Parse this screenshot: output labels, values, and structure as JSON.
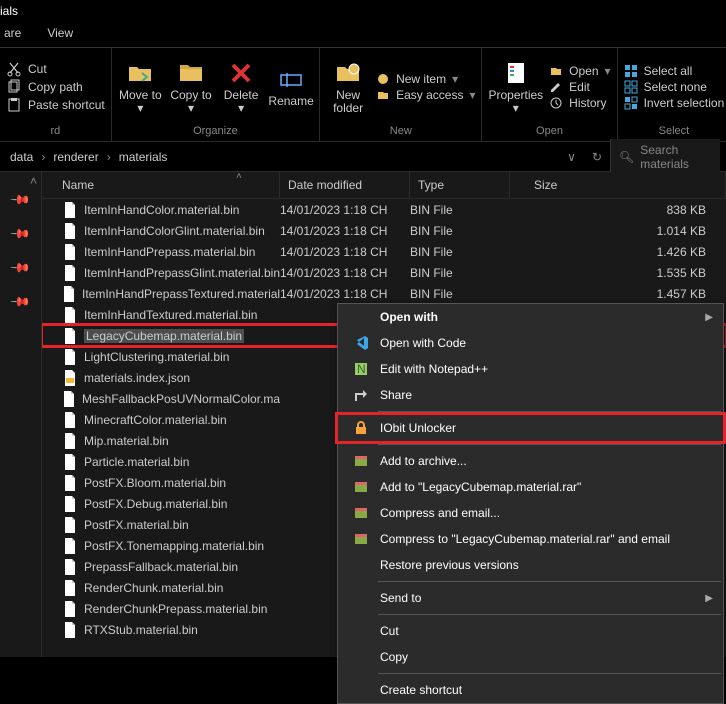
{
  "title": "ials",
  "tabs": [
    "are",
    "View"
  ],
  "ribbon": {
    "clipboard": {
      "cut": "Cut",
      "copy_path": "Copy path",
      "paste_shortcut": "Paste shortcut",
      "group": "rd"
    },
    "organize": {
      "move_to": "Move\nto",
      "copy_to": "Copy\nto",
      "delete": "Delete",
      "rename": "Rename",
      "group": "Organize"
    },
    "new": {
      "new_folder": "New\nfolder",
      "new_item": "New item",
      "easy_access": "Easy access",
      "group": "New"
    },
    "open": {
      "properties": "Properties",
      "open": "Open",
      "edit": "Edit",
      "history": "History",
      "group": "Open"
    },
    "select": {
      "select_all": "Select all",
      "select_none": "Select none",
      "invert": "Invert selection",
      "group": "Select"
    }
  },
  "breadcrumb": [
    "data",
    "renderer",
    "materials"
  ],
  "search_placeholder": "Search materials",
  "columns": {
    "name": "Name",
    "date": "Date modified",
    "type": "Type",
    "size": "Size"
  },
  "files": [
    {
      "name": "ItemInHandColor.material.bin",
      "date": "14/01/2023 1:18 CH",
      "type": "BIN File",
      "size": "838 KB"
    },
    {
      "name": "ItemInHandColorGlint.material.bin",
      "date": "14/01/2023 1:18 CH",
      "type": "BIN File",
      "size": "1.014 KB"
    },
    {
      "name": "ItemInHandPrepass.material.bin",
      "date": "14/01/2023 1:18 CH",
      "type": "BIN File",
      "size": "1.426 KB"
    },
    {
      "name": "ItemInHandPrepassGlint.material.bin",
      "date": "14/01/2023 1:18 CH",
      "type": "BIN File",
      "size": "1.535 KB"
    },
    {
      "name": "ItemInHandPrepassTextured.material.bin",
      "date": "14/01/2023 1:18 CH",
      "type": "BIN File",
      "size": "1.457 KB"
    },
    {
      "name": "ItemInHandTextured.material.bin"
    },
    {
      "name": "LegacyCubemap.material.bin",
      "selected": true
    },
    {
      "name": "LightClustering.material.bin"
    },
    {
      "name": "materials.index.json",
      "json": true
    },
    {
      "name": "MeshFallbackPosUVNormalColor.mat"
    },
    {
      "name": "MinecraftColor.material.bin"
    },
    {
      "name": "Mip.material.bin"
    },
    {
      "name": "Particle.material.bin"
    },
    {
      "name": "PostFX.Bloom.material.bin"
    },
    {
      "name": "PostFX.Debug.material.bin"
    },
    {
      "name": "PostFX.material.bin"
    },
    {
      "name": "PostFX.Tonemapping.material.bin"
    },
    {
      "name": "PrepassFallback.material.bin"
    },
    {
      "name": "RenderChunk.material.bin"
    },
    {
      "name": "RenderChunkPrepass.material.bin"
    },
    {
      "name": "RTXStub.material.bin"
    }
  ],
  "context": {
    "open_with": "Open with",
    "open_code": "Open with Code",
    "edit_npp": "Edit with Notepad++",
    "share": "Share",
    "iobit": "IObit Unlocker",
    "add_archive": "Add to archive...",
    "add_rar": "Add to \"LegacyCubemap.material.rar\"",
    "compress_email": "Compress and email...",
    "compress_rar_email": "Compress to \"LegacyCubemap.material.rar\" and email",
    "restore": "Restore previous versions",
    "send_to": "Send to",
    "cut": "Cut",
    "copy": "Copy",
    "create_shortcut": "Create shortcut"
  }
}
